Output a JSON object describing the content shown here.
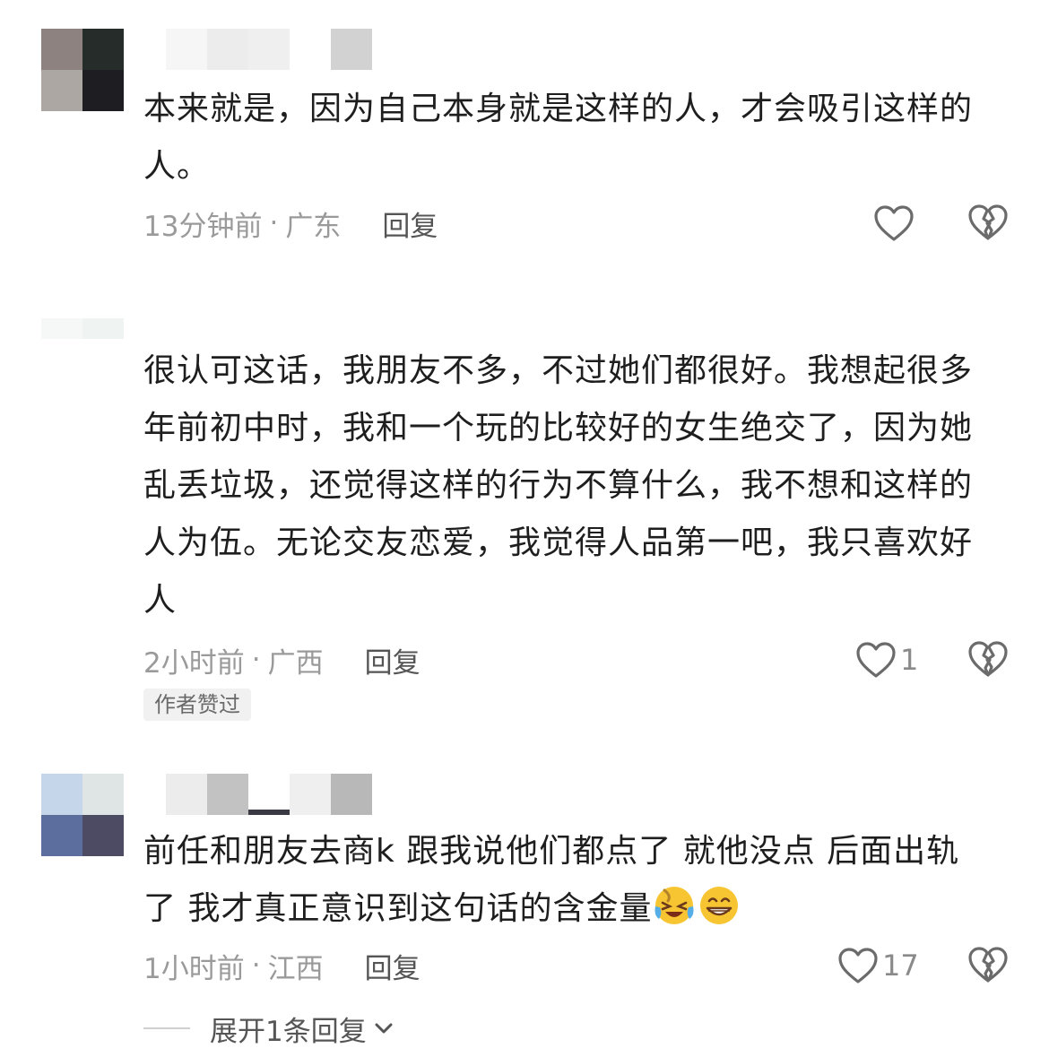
{
  "comments": [
    {
      "text": "本来就是，因为自己本身就是这样的人，才会吸引这样的人。",
      "time": "13分钟前",
      "region": "广东",
      "reply_label": "回复",
      "likes": "",
      "avatar_colors": [
        "#8e8281",
        "#262c29",
        "#aca7a3",
        "#1e1e22"
      ],
      "name_colors": [
        "#f6f6f6",
        "#ececec",
        "#efefef",
        "#ffffff",
        "#d2d2d2"
      ]
    },
    {
      "text": "很认可这话，我朋友不多，不过她们都很好。我想起很多年前初中时，我和一个玩的比较好的女生绝交了，因为她乱丢垃圾，还觉得这样的行为不算什么，我不想和这样的人为伍。无论交友恋爱，我觉得人品第一吧，我只喜欢好人",
      "time": "2小时前",
      "region": "广西",
      "reply_label": "回复",
      "likes": "1",
      "badge": "作者赞过",
      "avatar_colors": [
        "#f6f8f7",
        "#eff3f2",
        "#f3f6f5",
        "#fbfcfc"
      ]
    },
    {
      "text_parts": [
        "前任和朋友去商k 跟我说他们都点了 就他没点 后面出轨了 我才真正意识到这句话的含金量"
      ],
      "emojis": [
        "face-with-tears-of-joy-icon",
        "grinning-face-icon"
      ],
      "time": "1小时前",
      "region": "江西",
      "reply_label": "回复",
      "likes": "17",
      "avatar_colors": [
        "#c6d6ea",
        "#dfe4e5",
        "#5b6e9e",
        "#4d4a64"
      ],
      "name_colors": [
        "#ececec",
        "#c2c2c2",
        "#ffffff",
        "#efefef",
        "#b8b8b8"
      ]
    }
  ],
  "expand_replies": "展开1条回复",
  "separator": "·",
  "colors": {
    "text": "#1e1e1e",
    "meta": "#9a9a9a",
    "reply": "#555555",
    "icon": "#6b6b6b"
  }
}
